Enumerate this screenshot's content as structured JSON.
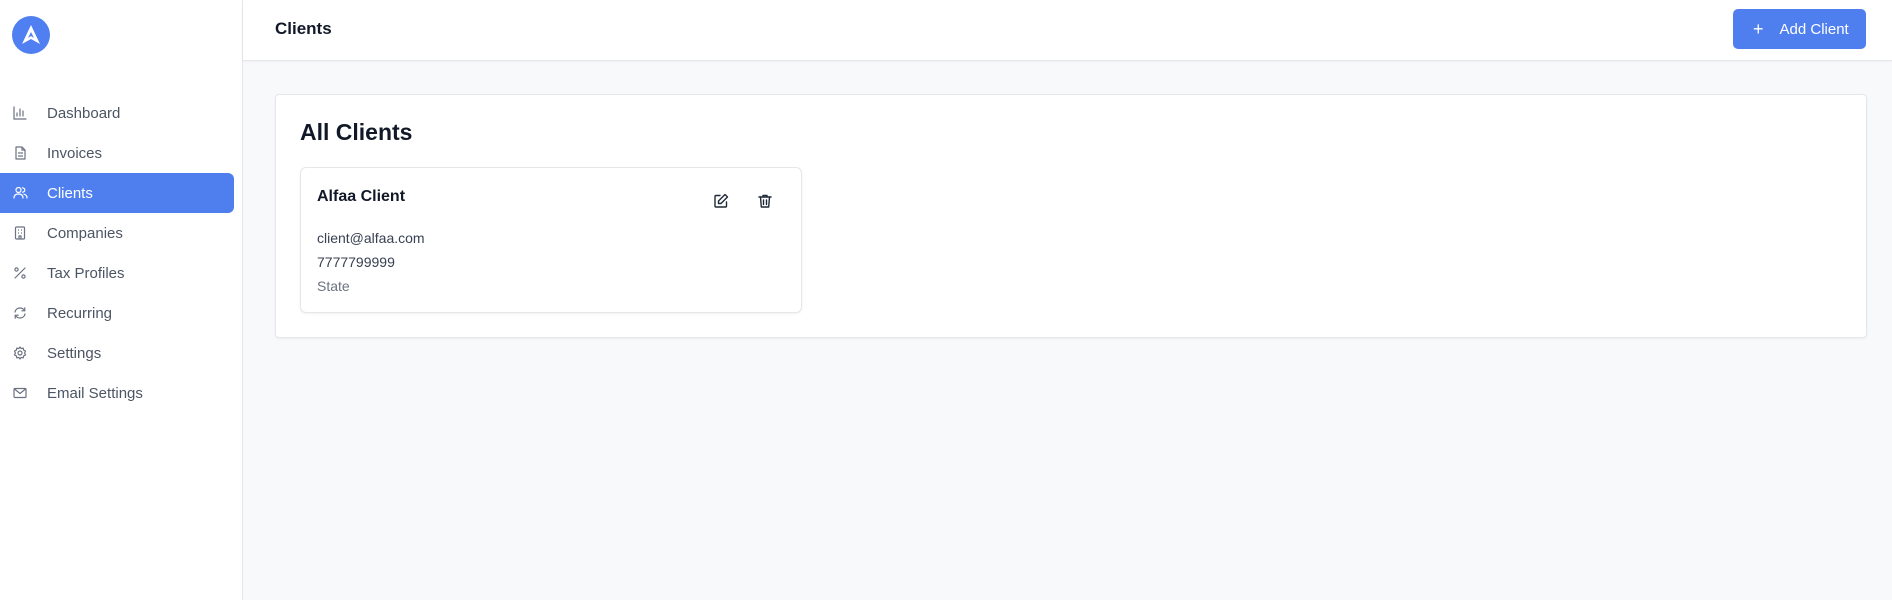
{
  "sidebar": {
    "logo_icon": "logo-a-icon",
    "items": [
      {
        "label": "Dashboard",
        "icon": "bar-chart-icon",
        "active": false
      },
      {
        "label": "Invoices",
        "icon": "file-text-icon",
        "active": false
      },
      {
        "label": "Clients",
        "icon": "users-icon",
        "active": true
      },
      {
        "label": "Companies",
        "icon": "building-icon",
        "active": false
      },
      {
        "label": "Tax Profiles",
        "icon": "percent-icon",
        "active": false
      },
      {
        "label": "Recurring",
        "icon": "refresh-icon",
        "active": false
      },
      {
        "label": "Settings",
        "icon": "gear-icon",
        "active": false
      },
      {
        "label": "Email Settings",
        "icon": "mail-icon",
        "active": false
      }
    ]
  },
  "header": {
    "title": "Clients",
    "add_button_label": "Add Client",
    "add_button_icon": "plus-icon"
  },
  "main": {
    "section_title": "All Clients",
    "clients": [
      {
        "name": "Alfaa Client",
        "email": "client@alfaa.com",
        "phone": "7777799999",
        "state": "State"
      }
    ]
  },
  "colors": {
    "accent": "#4f7fef",
    "background": "#f8f9fb",
    "border": "#e5e7eb"
  }
}
